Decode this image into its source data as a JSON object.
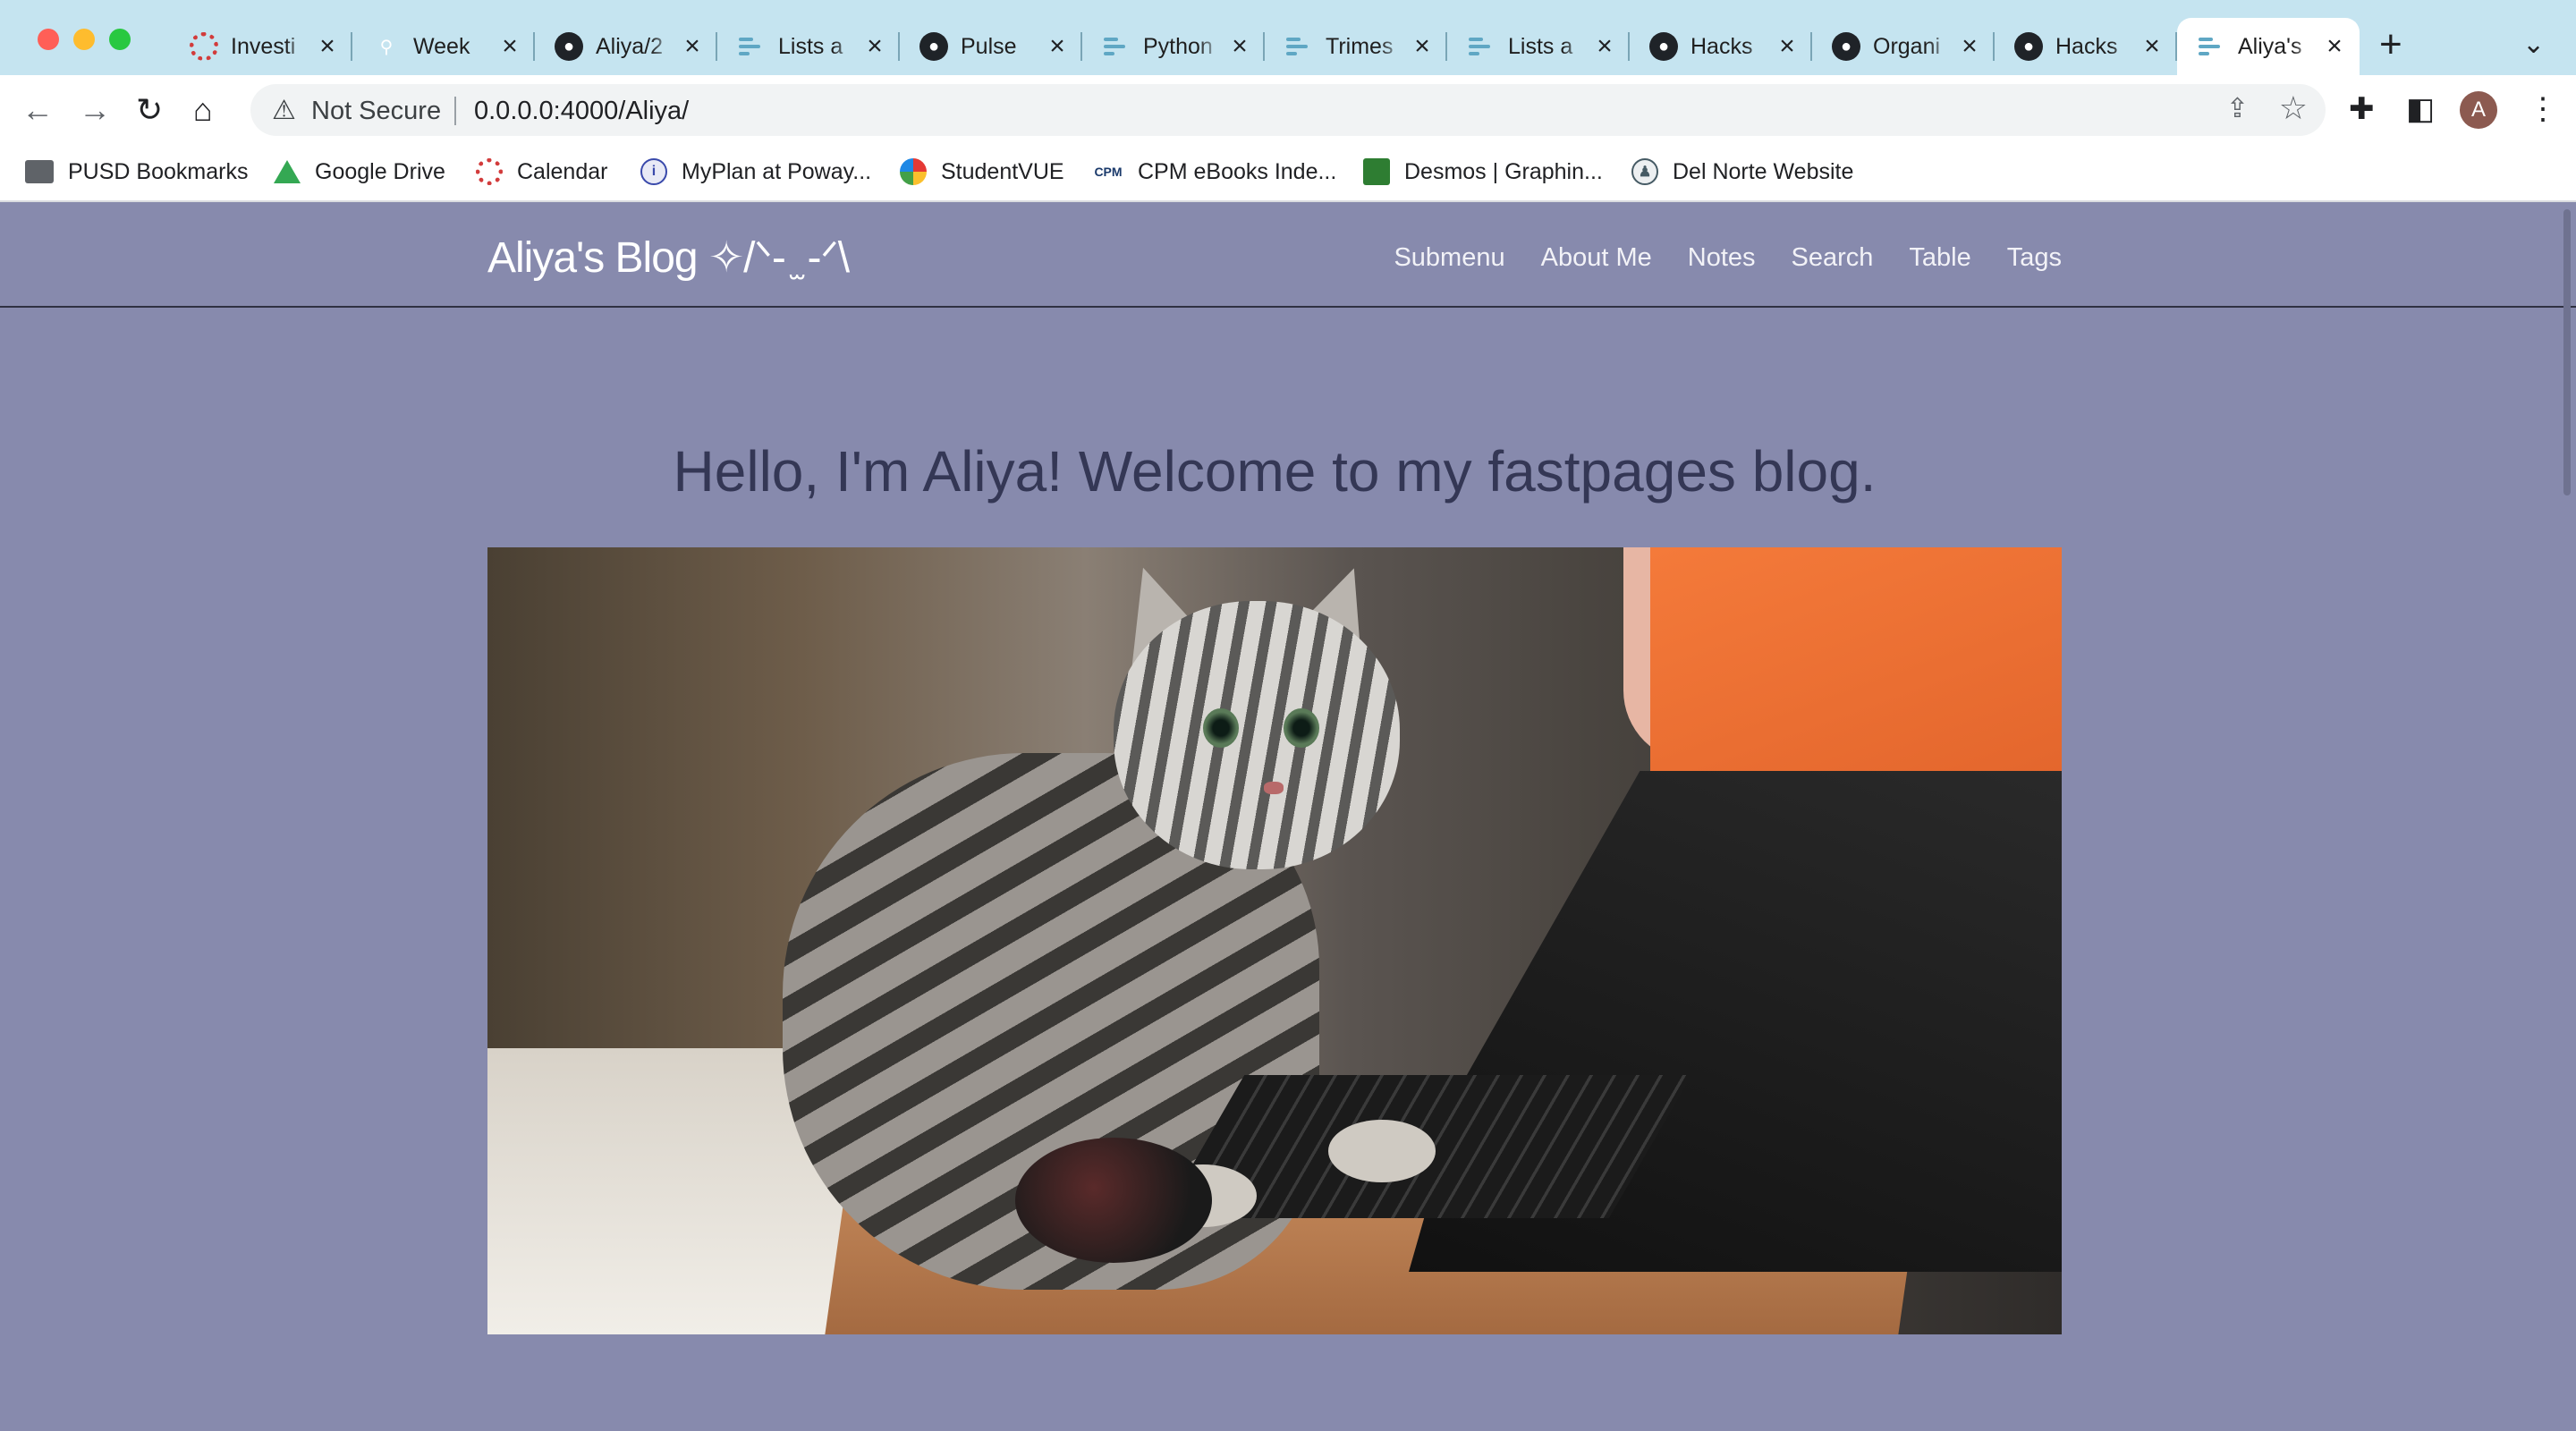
{
  "browser": {
    "tabs": [
      {
        "title": "Investi",
        "favicon": "dotted-circle-icon"
      },
      {
        "title": "Week",
        "favicon": "magnifier-icon"
      },
      {
        "title": "Aliya/2",
        "favicon": "github-icon"
      },
      {
        "title": "Lists a",
        "favicon": "fastpages-icon"
      },
      {
        "title": "Pulse",
        "favicon": "github-icon"
      },
      {
        "title": "Python",
        "favicon": "fastpages-icon"
      },
      {
        "title": "Trimes",
        "favicon": "fastpages-icon"
      },
      {
        "title": "Lists a",
        "favicon": "fastpages-icon"
      },
      {
        "title": "Hacks",
        "favicon": "github-icon"
      },
      {
        "title": "Organi",
        "favicon": "github-icon"
      },
      {
        "title": "Hacks",
        "favicon": "github-icon"
      },
      {
        "title": "Aliya's",
        "favicon": "fastpages-icon",
        "active": true
      }
    ],
    "security_label": "Not Secure",
    "url": "0.0.0.0:4000/Aliya/",
    "profile_initial": "A",
    "bookmarks": [
      {
        "label": "PUSD Bookmarks",
        "icon": "folder-icon"
      },
      {
        "label": "Google Drive",
        "icon": "drive-icon"
      },
      {
        "label": "Calendar",
        "icon": "calendar-icon"
      },
      {
        "label": "MyPlan at Poway...",
        "icon": "myplan-icon"
      },
      {
        "label": "StudentVUE",
        "icon": "studentvue-icon"
      },
      {
        "label": "CPM eBooks Inde...",
        "icon": "cpm-icon"
      },
      {
        "label": "Desmos | Graphin...",
        "icon": "desmos-icon"
      },
      {
        "label": "Del Norte Website",
        "icon": "delnorte-icon"
      }
    ],
    "cpm_icon_text": "CPM"
  },
  "site": {
    "title": "Aliya's Blog ✧/ᐠ- ̫ -ᐟ\\",
    "nav": [
      "Submenu",
      "About Me",
      "Notes",
      "Search",
      "Table",
      "Tags"
    ],
    "headline": "Hello, I'm Aliya! Welcome to my fastpages blog."
  },
  "colors": {
    "tabstrip": "#c5e4f0",
    "page_background": "#878aad",
    "headline": "#343755"
  }
}
